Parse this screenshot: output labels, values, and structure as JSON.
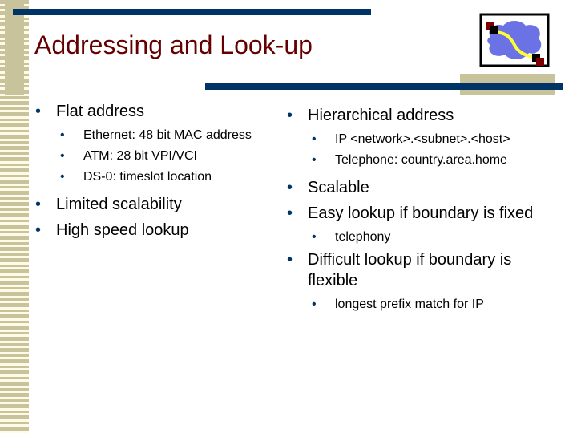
{
  "slide": {
    "title": "Addressing and Look-up",
    "colors": {
      "title": "#660000",
      "rule": "#003366",
      "accent_strip": "#c8c39a",
      "strip_light": "#fffbe8",
      "bullet": "#003366"
    },
    "logo_icon": "network-cloud-icon"
  },
  "left": {
    "heading": "Flat address",
    "sub_items": [
      "Ethernet: 48 bit MAC address",
      "ATM: 28 bit VPI/VCI",
      "DS-0: timeslot location"
    ],
    "points": [
      "Limited scalability",
      "High speed lookup"
    ]
  },
  "right": {
    "heading": "Hierarchical address",
    "sub_items": [
      "IP <network>.<subnet>.<host>",
      "Telephone: country.area.home"
    ],
    "point1": "Scalable",
    "point2": "Easy lookup if boundary is fixed",
    "point2_sub": "telephony",
    "point3": "Difficult lookup if boundary is flexible",
    "point3_sub": "longest prefix match for IP"
  }
}
